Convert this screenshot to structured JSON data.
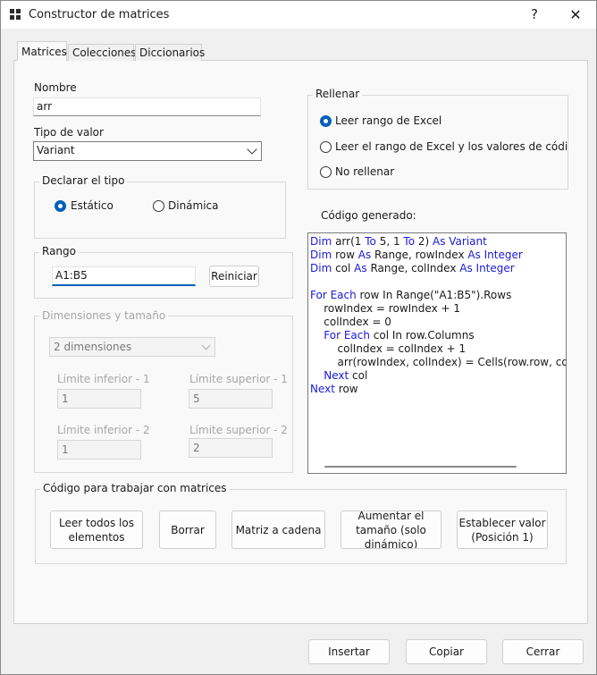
{
  "window": {
    "title": "Constructor de matrices",
    "help_label": "?",
    "close_label": "✕"
  },
  "tabs": [
    {
      "label": "Matrices"
    },
    {
      "label": "Colecciones"
    },
    {
      "label": "Diccionarios"
    }
  ],
  "form": {
    "nombre_label": "Nombre",
    "nombre_value": "arr",
    "tipo_label": "Tipo de valor",
    "tipo_value": "Variant",
    "declarar_title": "Declarar el tipo",
    "declarar_options": [
      {
        "label": "Estático",
        "checked": true
      },
      {
        "label": "Dinámica",
        "checked": false
      }
    ],
    "rango_title": "Rango",
    "rango_value": "A1:B5",
    "reiniciar_label": "Reiniciar",
    "dimensiones_title": "Dimensiones y tamaño",
    "dimensiones_value": "2 dimensiones",
    "limites": [
      {
        "label": "Límite inferior - 1",
        "value": "1"
      },
      {
        "label": "Límite superior - 1",
        "value": "5"
      },
      {
        "label": "Límite inferior - 2",
        "value": "1"
      },
      {
        "label": "Límite superior - 2",
        "value": "2"
      }
    ]
  },
  "rellenar": {
    "title": "Rellenar",
    "options": [
      {
        "label": "Leer rango de Excel",
        "checked": true
      },
      {
        "label": "Leer el rango de Excel y los valores de código du",
        "checked": false
      },
      {
        "label": "No rellenar",
        "checked": false
      }
    ]
  },
  "code": {
    "title": "Código generado:",
    "lines": [
      "Dim arr(1 To 5, 1 To 2) As Variant",
      "Dim row As Range, rowIndex As Integer",
      "Dim col As Range, colIndex As Integer",
      "",
      "For Each row In Range(\"A1:B5\").Rows",
      "    rowIndex = rowIndex + 1",
      "    colIndex = 0",
      "    For Each col In row.Columns",
      "        colIndex = colIndex + 1",
      "        arr(rowIndex, colIndex) = Cells(row.row, col.Colum",
      "    Next col",
      "Next row"
    ]
  },
  "actions": {
    "title": "Código para trabajar con matrices",
    "buttons": [
      "Leer todos los elementos",
      "Borrar",
      "Matriz a cadena",
      "Aumentar el tamaño (solo dinámico)",
      "Establecer valor (Posición 1)"
    ]
  },
  "footer": {
    "insertar_label": "Insertar",
    "copiar_label": "Copiar",
    "cerrar_label": "Cerrar"
  },
  "colors": {
    "accent": "#005fb8",
    "keyword": "#1a1ad6"
  }
}
